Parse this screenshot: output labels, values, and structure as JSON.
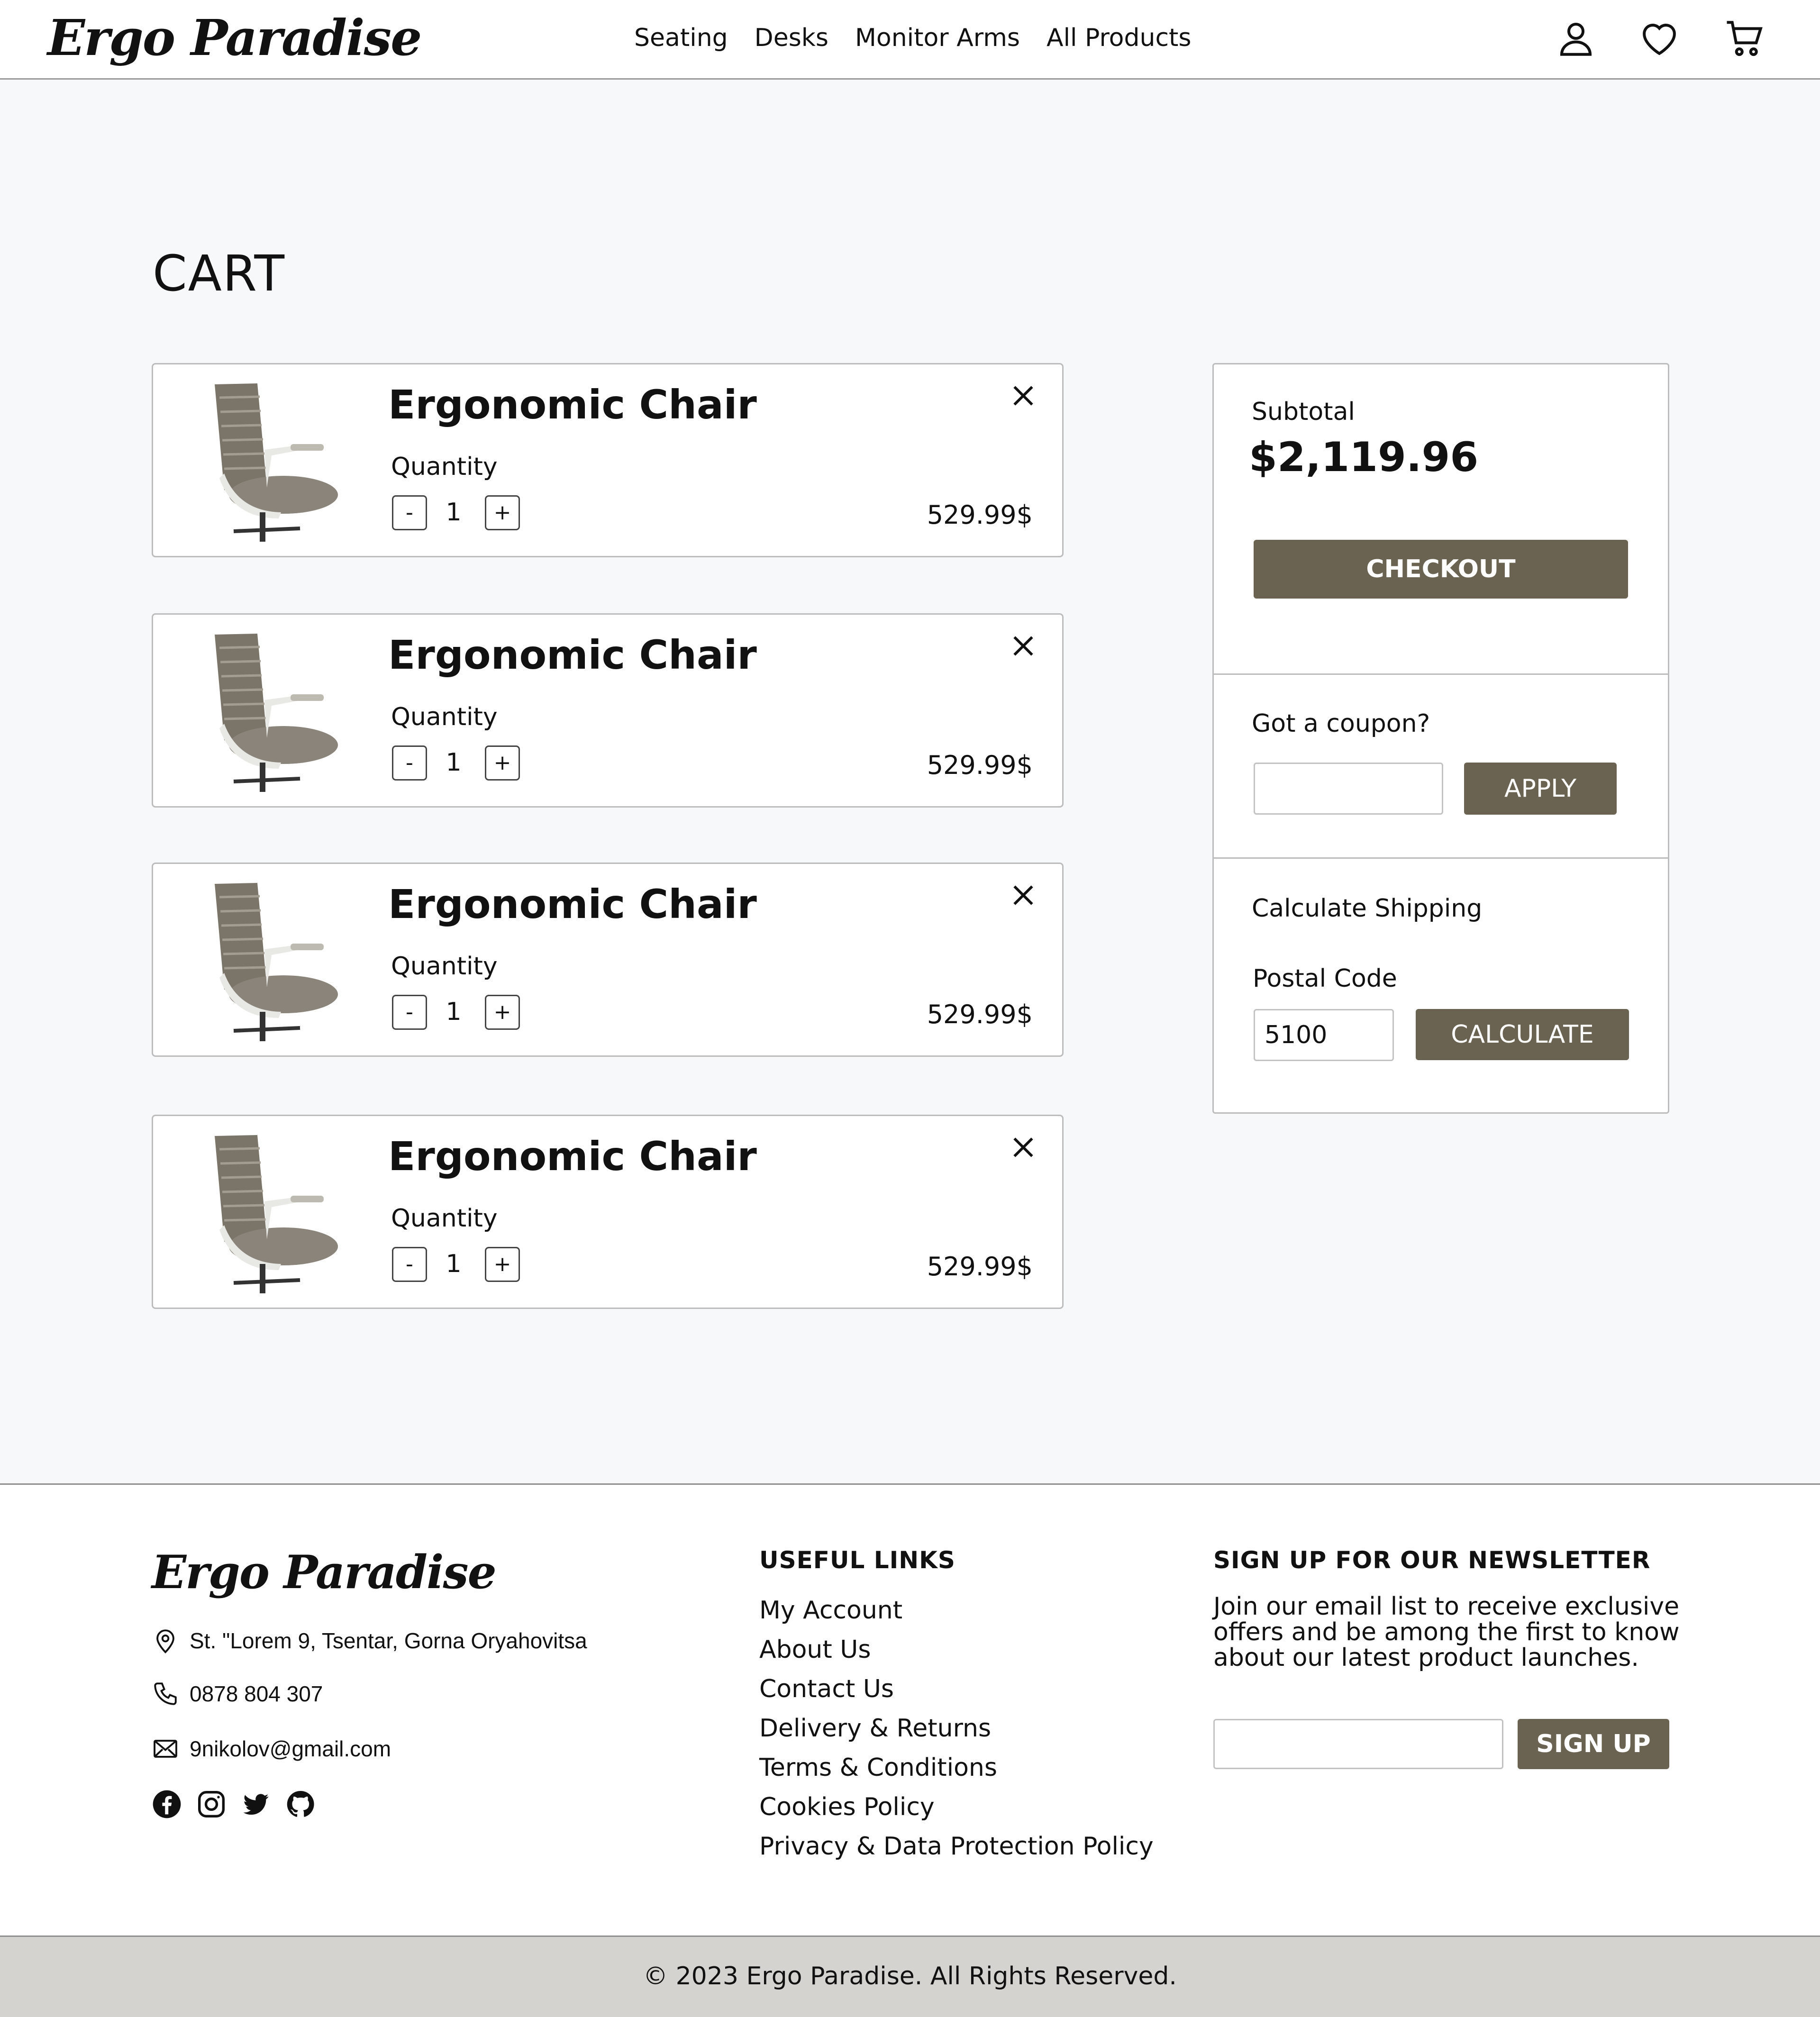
{
  "brand": {
    "logo_text": "Ergo Paradise"
  },
  "nav": {
    "items": [
      "Seating",
      "Desks",
      "Monitor Arms",
      "All Products"
    ]
  },
  "header_icons": [
    "user-icon",
    "heart-icon",
    "cart-icon"
  ],
  "cart": {
    "title": "CART",
    "quantity_label": "Quantity",
    "minus_label": "-",
    "plus_label": "+",
    "items": [
      {
        "name": "Ergonomic Chair",
        "quantity": "1",
        "price": "529.99$"
      },
      {
        "name": "Ergonomic Chair",
        "quantity": "1",
        "price": "529.99$"
      },
      {
        "name": "Ergonomic Chair",
        "quantity": "1",
        "price": "529.99$"
      },
      {
        "name": "Ergonomic Chair",
        "quantity": "1",
        "price": "529.99$"
      }
    ]
  },
  "summary": {
    "subtotal_label": "Subtotal",
    "subtotal_value": "$2,119.96",
    "checkout_label": "CHECKOUT",
    "coupon_label": "Got a coupon?",
    "coupon_value": "",
    "apply_label": "APPLY",
    "shipping_label": "Calculate Shipping",
    "postal_label": "Postal Code",
    "postal_value": "5100",
    "calculate_label": "CALCULATE"
  },
  "footer": {
    "address": "St. \"Lorem 9, Tsentar, Gorna Oryahovitsa",
    "phone": "0878 804 307",
    "email": "9nikolov@gmail.com",
    "socials": [
      "facebook-icon",
      "instagram-icon",
      "twitter-icon",
      "github-icon"
    ],
    "links_heading": "USEFUL LINKS",
    "links": [
      "My Account",
      "About Us",
      "Contact Us",
      "Delivery & Returns",
      "Terms & Conditions",
      "Cookies Policy",
      "Privacy & Data Protection Policy"
    ],
    "newsletter_heading": "SIGN UP FOR OUR NEWSLETTER",
    "newsletter_text": "Join our email list to receive exclusive offers and be among the first to know about our latest product launches.",
    "newsletter_value": "",
    "signup_label": "SIGN UP",
    "copyright": "© 2023 Ergo Paradise. All Rights Reserved."
  },
  "colors": {
    "accent": "#6b6352",
    "page_bg": "#f7f8fa",
    "footer_bar": "#d4d3d0"
  }
}
